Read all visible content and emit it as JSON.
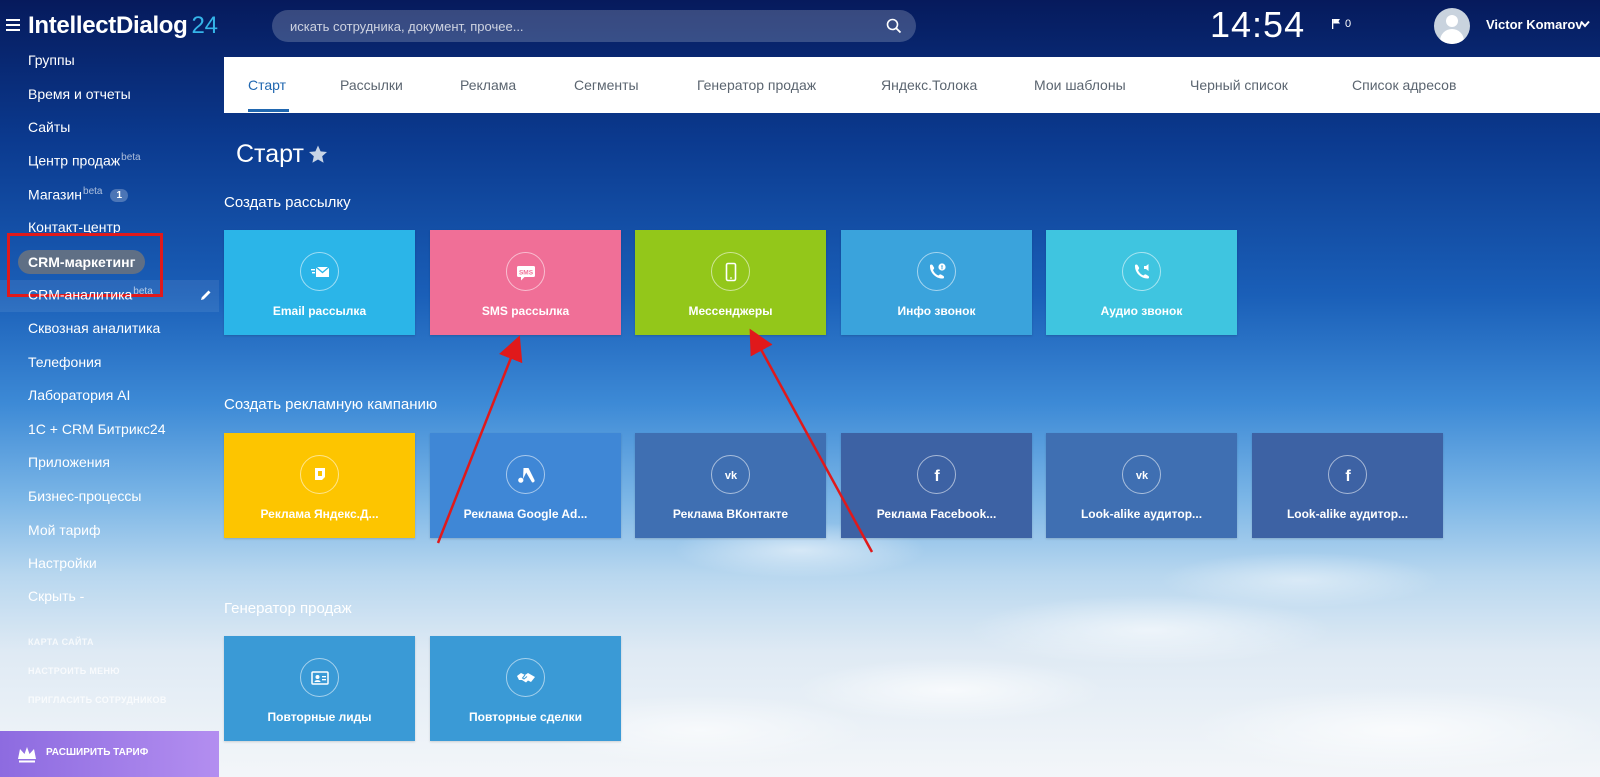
{
  "header": {
    "logo_main": "IntellectDialog",
    "logo_num": "24",
    "search_placeholder": "искать сотрудника, документ, прочее...",
    "clock": "14:54",
    "flag_count": "0",
    "user_name": "Victor Komarov"
  },
  "sidebar": {
    "items": [
      {
        "label": "Группы"
      },
      {
        "label": "Время и отчеты"
      },
      {
        "label": "Сайты"
      },
      {
        "label": "Центр продаж",
        "sup": "beta"
      },
      {
        "label": "Магазин",
        "sup": "beta",
        "badge": "1"
      },
      {
        "label": "Контакт-центр"
      },
      {
        "label": "CRM-маркетинг"
      },
      {
        "label": "CRM-аналитика",
        "sup": "beta"
      },
      {
        "label": "Сквозная аналитика"
      },
      {
        "label": "Телефония"
      },
      {
        "label": "Лаборатория AI"
      },
      {
        "label": "1С + CRM Битрикс24"
      },
      {
        "label": "Приложения"
      },
      {
        "label": "Бизнес-процессы"
      },
      {
        "label": "Мой тариф"
      },
      {
        "label": "Настройки"
      },
      {
        "label": "Скрыть -"
      }
    ],
    "links": [
      "КАРТА САЙТА",
      "НАСТРОИТЬ МЕНЮ",
      "ПРИГЛАСИТЬ СОТРУДНИКОВ"
    ],
    "upgrade_label": "РАСШИРИТЬ ТАРИФ"
  },
  "tabs": [
    "Старт",
    "Рассылки",
    "Реклама",
    "Сегменты",
    "Генератор продаж",
    "Яндекс.Толока",
    "Мои шаблоны",
    "Черный список",
    "Список адресов"
  ],
  "page_title": "Старт",
  "sections": [
    {
      "title": "Создать рассылку",
      "tiles": [
        {
          "label": "Email рассылка",
          "icon": "email-icon",
          "color": "#2bb5e8"
        },
        {
          "label": "SMS рассылка",
          "icon": "sms-icon",
          "color": "#f06f97"
        },
        {
          "label": "Мессенджеры",
          "icon": "phone-icon",
          "color": "#93c71a"
        },
        {
          "label": "Инфо звонок",
          "icon": "info-call-icon",
          "color": "#3aa3dc"
        },
        {
          "label": "Аудио звонок",
          "icon": "audio-call-icon",
          "color": "#3fc5e0"
        }
      ]
    },
    {
      "title": "Создать рекламную кампанию",
      "tiles": [
        {
          "label": "Реклама Яндекс.Д...",
          "icon": "yandex-direct-icon",
          "color": "#fdc500"
        },
        {
          "label": "Реклама Google Ad...",
          "icon": "google-ads-icon",
          "color": "#3f87d6"
        },
        {
          "label": "Реклама ВКонтакте",
          "icon": "vk-icon",
          "color": "#3f6fb2"
        },
        {
          "label": "Реклама Facebook...",
          "icon": "facebook-icon",
          "color": "#3d62a4"
        },
        {
          "label": "Look-alike аудитор...",
          "icon": "vk-icon",
          "color": "#3f6fb2"
        },
        {
          "label": "Look-alike аудитор...",
          "icon": "facebook-icon",
          "color": "#3d62a4"
        }
      ]
    },
    {
      "title": "Генератор продаж",
      "tiles": [
        {
          "label": "Повторные лиды",
          "icon": "leads-icon",
          "color": "#3a9ad6"
        },
        {
          "label": "Повторные сделки",
          "icon": "handshake-icon",
          "color": "#3a9ad6"
        }
      ]
    }
  ],
  "colors": {
    "highlight": "#e0191b",
    "annotation_arrow": "#e0191b",
    "tab_active": "#2067b0",
    "logo_accent": "#35b4e8"
  }
}
